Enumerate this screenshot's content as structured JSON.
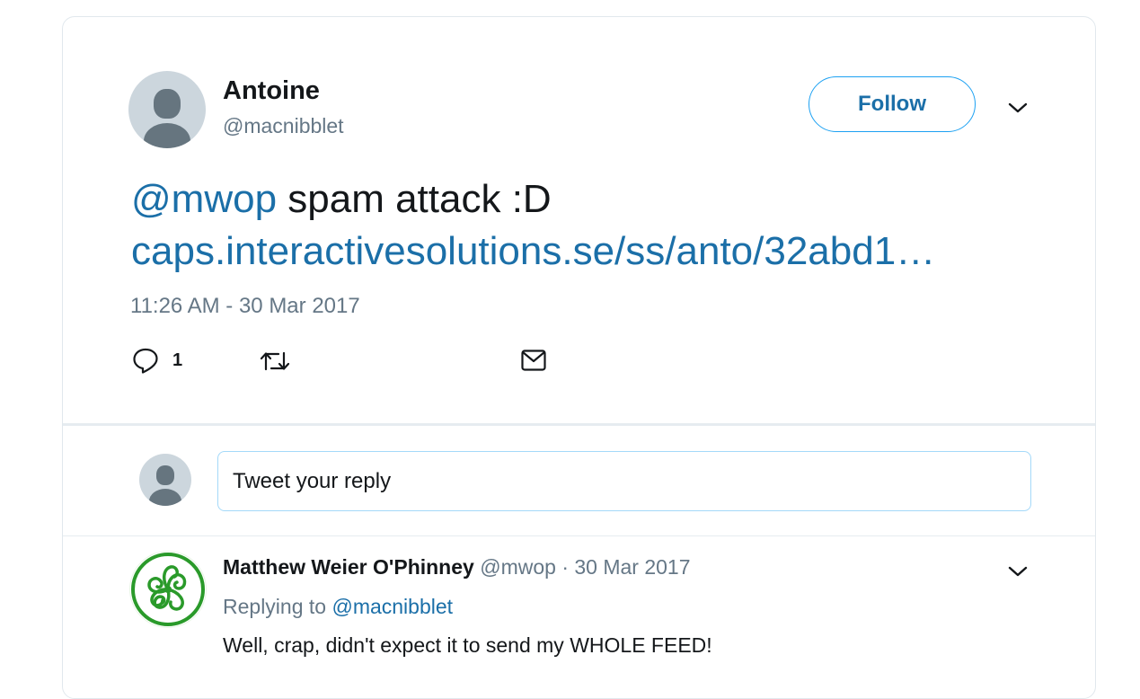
{
  "tweet": {
    "author_name": "Antoine",
    "author_handle": "@macnibblet",
    "follow_label": "Follow",
    "text_mention": "@mwop",
    "text_body": " spam attack :D",
    "text_link": "caps.interactivesolutions.se/ss/anto/32abd1…",
    "timestamp": "11:26 AM - 30 Mar 2017",
    "reply_count": "1",
    "icons": [
      "profile-avatar",
      "chevron-down-icon",
      "reply-icon",
      "retweet-icon",
      "mail-icon"
    ]
  },
  "composer": {
    "placeholder": "Tweet your reply"
  },
  "reply": {
    "author_name": "Matthew Weier O'Phinney",
    "author_handle": "@mwop",
    "separator": "·",
    "date": "30 Mar 2017",
    "replying_prefix": "Replying to",
    "replying_handle": "@macnibblet",
    "text": "Well, crap, didn't expect it to send my WHOLE FEED!"
  },
  "colors": {
    "link": "#1b6fa8",
    "accent_border": "#1da1f2",
    "muted": "#657786",
    "text": "#14171a",
    "avatar_green": "#2a9a2a"
  }
}
